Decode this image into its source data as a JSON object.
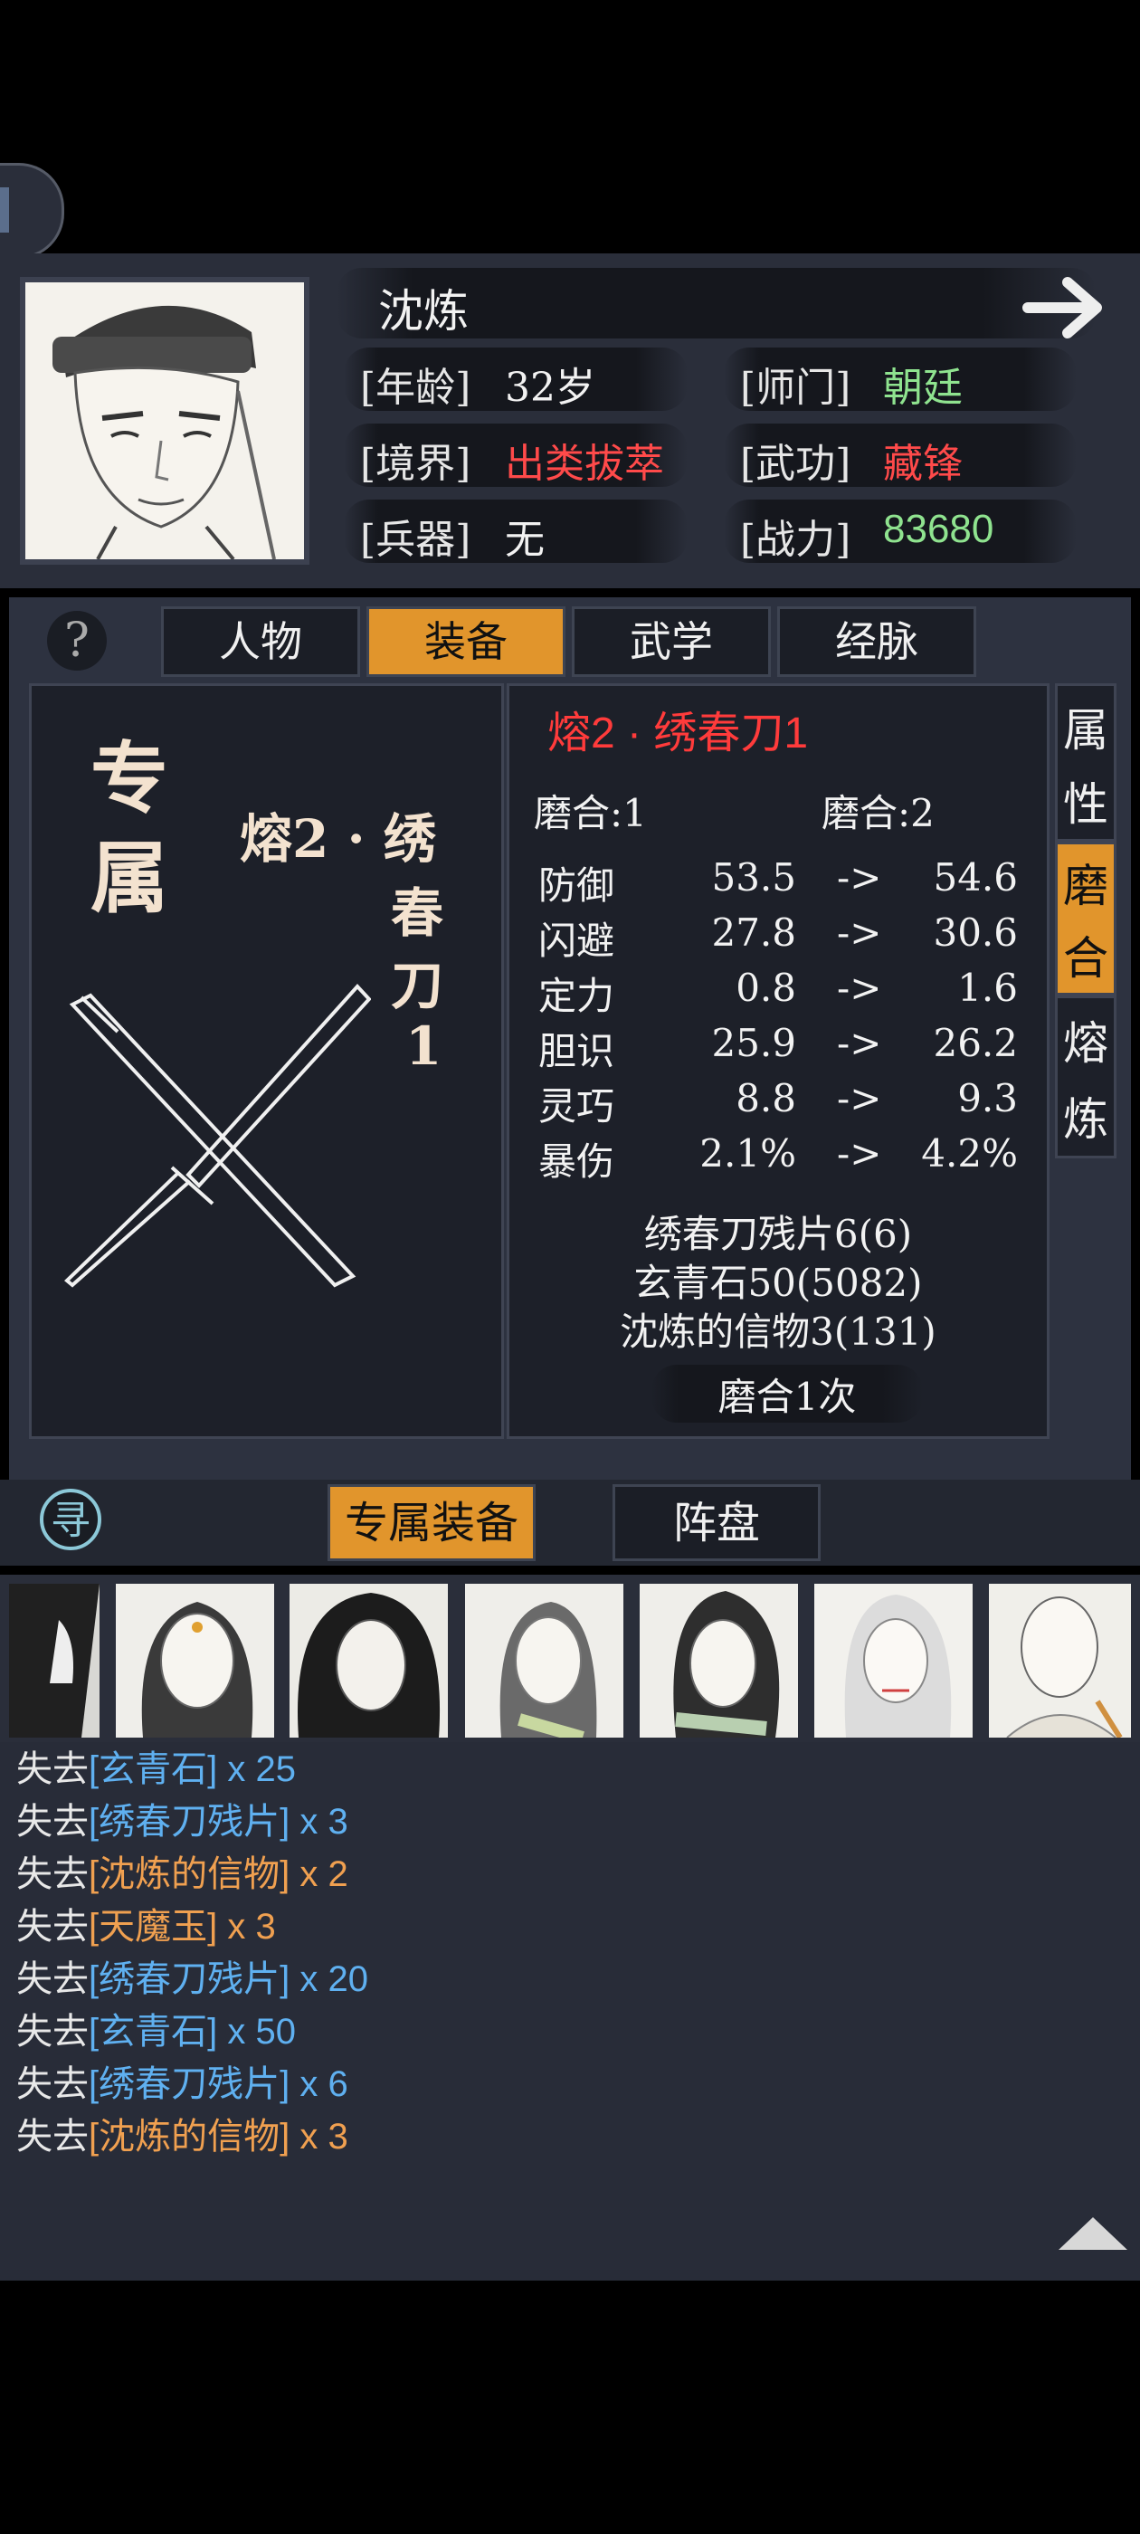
{
  "character": {
    "name": "沈炼",
    "fields": [
      {
        "label": "[年龄]",
        "value": "32岁",
        "color": "#f2f2f2"
      },
      {
        "label": "[师门]",
        "value": "朝廷",
        "color": "#8fe38f"
      },
      {
        "label": "[境界]",
        "value": "出类拔萃",
        "color": "#ff4a4a"
      },
      {
        "label": "[武功]",
        "value": "藏锋",
        "color": "#ff4a4a"
      },
      {
        "label": "[兵器]",
        "value": "无",
        "color": "#f2f2f2"
      },
      {
        "label": "[战力]",
        "value": "83680",
        "color": "#8fe38f"
      }
    ]
  },
  "tabs": [
    "人物",
    "装备",
    "武学",
    "经脉"
  ],
  "active_tab": "装备",
  "equipment": {
    "badge_top": "专",
    "badge_bottom": "属",
    "name_vertical": [
      "熔2 · 绣",
      "春",
      "刀",
      "1"
    ],
    "title": "熔2 · 绣春刀1",
    "grind_from": "磨合:1",
    "grind_to": "磨合:2",
    "stats": [
      {
        "name": "防御",
        "from": "53.5",
        "to": "54.6"
      },
      {
        "name": "闪避",
        "from": "27.8",
        "to": "30.6"
      },
      {
        "name": "定力",
        "from": "0.8",
        "to": "1.6"
      },
      {
        "name": "胆识",
        "from": "25.9",
        "to": "26.2"
      },
      {
        "name": "灵巧",
        "from": "8.8",
        "to": "9.3"
      },
      {
        "name": "暴伤",
        "from": "2.1%",
        "to": "4.2%"
      }
    ],
    "arrow": "->",
    "materials": [
      "绣春刀残片6(6)",
      "玄青石50(5082)",
      "沈炼的信物3(131)"
    ],
    "action_button": "磨合1次"
  },
  "side_tabs": [
    [
      "属",
      "性"
    ],
    [
      "磨",
      "合"
    ],
    [
      "熔",
      "炼"
    ]
  ],
  "active_side_tab": 1,
  "bottom_tabs": [
    "专属装备",
    "阵盘"
  ],
  "search_glyph": "寻",
  "log_prefix": "失去",
  "log": [
    {
      "item": "[玄青石]",
      "qty": " x 25",
      "color": "#5fb0f0"
    },
    {
      "item": "[绣春刀残片]",
      "qty": " x 3",
      "color": "#5fb0f0"
    },
    {
      "item": "[沈炼的信物]",
      "qty": " x 2",
      "color": "#f0a050"
    },
    {
      "item": "[天魔玉]",
      "qty": " x 3",
      "color": "#f0a050"
    },
    {
      "item": "[绣春刀残片]",
      "qty": " x 20",
      "color": "#5fb0f0"
    },
    {
      "item": "[玄青石]",
      "qty": " x 50",
      "color": "#5fb0f0"
    },
    {
      "item": "[绣春刀残片]",
      "qty": " x 6",
      "color": "#5fb0f0"
    },
    {
      "item": "[沈炼的信物]",
      "qty": " x 3",
      "color": "#f0a050"
    }
  ],
  "icons": {
    "next": "arrow-right-icon",
    "help": "question-icon",
    "search": "search-icon",
    "scroll": "scroll-up-icon"
  }
}
